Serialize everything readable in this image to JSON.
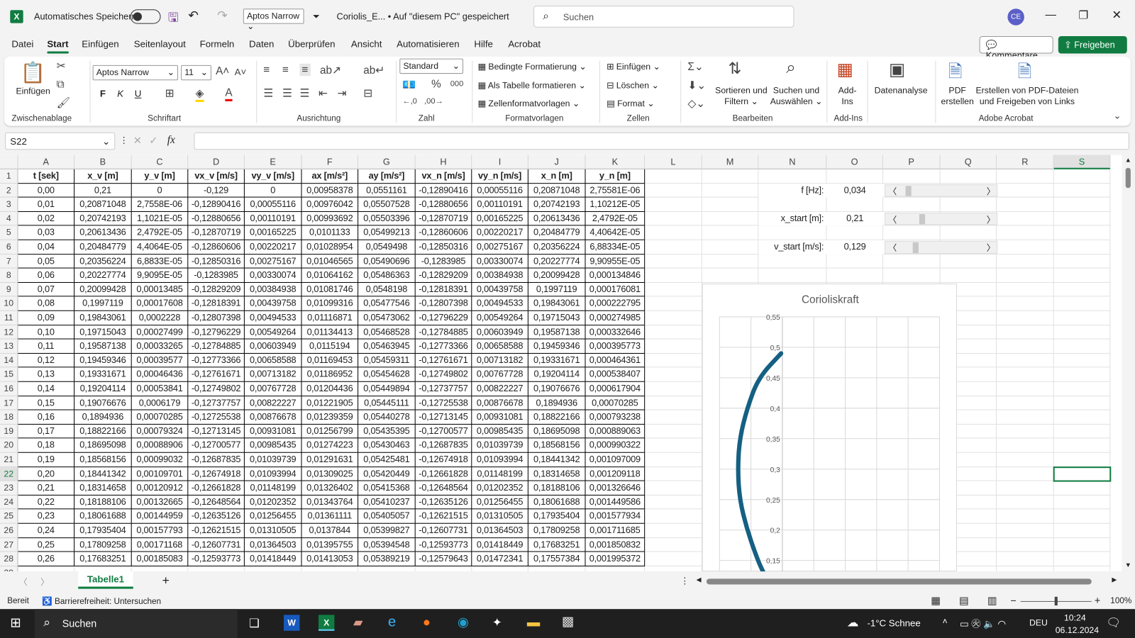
{
  "titlebar": {
    "autosave": "Automatisches Speichern",
    "font_quick": "Aptos Narrow",
    "doc_title": "Coriolis_E... • Auf \"diesem PC\" gespeichert",
    "search_placeholder": "Suchen",
    "avatar": "CE"
  },
  "menu": {
    "tabs": [
      "Datei",
      "Start",
      "Einfügen",
      "Seitenlayout",
      "Formeln",
      "Daten",
      "Überprüfen",
      "Ansicht",
      "Automatisieren",
      "Hilfe",
      "Acrobat"
    ],
    "active": "Start",
    "comments": "Kommentare",
    "share": "Freigeben"
  },
  "ribbon": {
    "clipboard": {
      "paste": "Einfügen",
      "label": "Zwischenablage"
    },
    "font": {
      "name": "Aptos Narrow",
      "size": "11",
      "bold": "F",
      "italic": "K",
      "underline": "U",
      "label": "Schriftart"
    },
    "alignment": {
      "label": "Ausrichtung"
    },
    "number": {
      "format": "Standard",
      "label": "Zahl"
    },
    "styles": {
      "conditional": "Bedingte Formatierung",
      "as_table": "Als Tabelle formatieren",
      "cell_styles": "Zellenformatvorlagen",
      "label": "Formatvorlagen"
    },
    "cells": {
      "insert": "Einfügen",
      "delete": "Löschen",
      "format": "Format",
      "label": "Zellen"
    },
    "editing": {
      "sort1": "Sortieren und",
      "sort2": "Filtern",
      "find1": "Suchen und",
      "find2": "Auswählen",
      "label": "Bearbeiten"
    },
    "addins": {
      "btn1": "Add-",
      "btn2": "Ins",
      "label": "Add-Ins"
    },
    "analysis": {
      "btn": "Datenanalyse"
    },
    "acrobat": {
      "pdf1": "PDF",
      "pdf2": "erstellen",
      "share1": "Erstellen von PDF-Dateien",
      "share2": "und Freigeben von Links",
      "label": "Adobe Acrobat"
    }
  },
  "formula_bar": {
    "name_box": "S22",
    "fx": "fx",
    "value": ""
  },
  "columns": [
    "A",
    "B",
    "C",
    "D",
    "E",
    "F",
    "G",
    "H",
    "I",
    "J",
    "K",
    "L",
    "M",
    "N",
    "O",
    "P",
    "Q",
    "R",
    "S"
  ],
  "table": {
    "headers": [
      "t [sek]",
      "x_v [m]",
      "y_v [m]",
      "vx_v [m/s]",
      "vy_v [m/s]",
      "ax [m/s²]",
      "ay [m/s²]",
      "vx_n [m/s]",
      "vy_n [m/s]",
      "x_n [m]",
      "y_n [m]"
    ],
    "rows": [
      [
        "0,00",
        "0,21",
        "0",
        "-0,129",
        "0",
        "0,00958378",
        "0,0551161",
        "-0,12890416",
        "0,00055116",
        "0,20871048",
        "2,75581E-06"
      ],
      [
        "0,01",
        "0,20871048",
        "2,7558E-06",
        "-0,12890416",
        "0,00055116",
        "0,00976042",
        "0,05507528",
        "-0,12880656",
        "0,00110191",
        "0,20742193",
        "1,10212E-05"
      ],
      [
        "0,02",
        "0,20742193",
        "1,1021E-05",
        "-0,12880656",
        "0,00110191",
        "0,00993692",
        "0,05503396",
        "-0,12870719",
        "0,00165225",
        "0,20613436",
        "2,4792E-05"
      ],
      [
        "0,03",
        "0,20613436",
        "2,4792E-05",
        "-0,12870719",
        "0,00165225",
        "0,0101133",
        "0,05499213",
        "-0,12860606",
        "0,00220217",
        "0,20484779",
        "4,40642E-05"
      ],
      [
        "0,04",
        "0,20484779",
        "4,4064E-05",
        "-0,12860606",
        "0,00220217",
        "0,01028954",
        "0,0549498",
        "-0,12850316",
        "0,00275167",
        "0,20356224",
        "6,88334E-05"
      ],
      [
        "0,05",
        "0,20356224",
        "6,8833E-05",
        "-0,12850316",
        "0,00275167",
        "0,01046565",
        "0,05490696",
        "-0,1283985",
        "0,00330074",
        "0,20227774",
        "9,90955E-05"
      ],
      [
        "0,06",
        "0,20227774",
        "9,9095E-05",
        "-0,1283985",
        "0,00330074",
        "0,01064162",
        "0,05486363",
        "-0,12829209",
        "0,00384938",
        "0,20099428",
        "0,000134846"
      ],
      [
        "0,07",
        "0,20099428",
        "0,00013485",
        "-0,12829209",
        "0,00384938",
        "0,01081746",
        "0,0548198",
        "-0,12818391",
        "0,00439758",
        "0,1997119",
        "0,000176081"
      ],
      [
        "0,08",
        "0,1997119",
        "0,00017608",
        "-0,12818391",
        "0,00439758",
        "0,01099316",
        "0,05477546",
        "-0,12807398",
        "0,00494533",
        "0,19843061",
        "0,000222795"
      ],
      [
        "0,09",
        "0,19843061",
        "0,0002228",
        "-0,12807398",
        "0,00494533",
        "0,01116871",
        "0,05473062",
        "-0,12796229",
        "0,00549264",
        "0,19715043",
        "0,000274985"
      ],
      [
        "0,10",
        "0,19715043",
        "0,00027499",
        "-0,12796229",
        "0,00549264",
        "0,01134413",
        "0,05468528",
        "-0,12784885",
        "0,00603949",
        "0,19587138",
        "0,000332646"
      ],
      [
        "0,11",
        "0,19587138",
        "0,00033265",
        "-0,12784885",
        "0,00603949",
        "0,0115194",
        "0,05463945",
        "-0,12773366",
        "0,00658588",
        "0,19459346",
        "0,000395773"
      ],
      [
        "0,12",
        "0,19459346",
        "0,00039577",
        "-0,12773366",
        "0,00658588",
        "0,01169453",
        "0,05459311",
        "-0,12761671",
        "0,00713182",
        "0,19331671",
        "0,000464361"
      ],
      [
        "0,13",
        "0,19331671",
        "0,00046436",
        "-0,12761671",
        "0,00713182",
        "0,01186952",
        "0,05454628",
        "-0,12749802",
        "0,00767728",
        "0,19204114",
        "0,000538407"
      ],
      [
        "0,14",
        "0,19204114",
        "0,00053841",
        "-0,12749802",
        "0,00767728",
        "0,01204436",
        "0,05449894",
        "-0,12737757",
        "0,00822227",
        "0,19076676",
        "0,000617904"
      ],
      [
        "0,15",
        "0,19076676",
        "0,0006179",
        "-0,12737757",
        "0,00822227",
        "0,01221905",
        "0,05445111",
        "-0,12725538",
        "0,00876678",
        "0,1894936",
        "0,00070285"
      ],
      [
        "0,16",
        "0,1894936",
        "0,00070285",
        "-0,12725538",
        "0,00876678",
        "0,01239359",
        "0,05440278",
        "-0,12713145",
        "0,00931081",
        "0,18822166",
        "0,000793238"
      ],
      [
        "0,17",
        "0,18822166",
        "0,00079324",
        "-0,12713145",
        "0,00931081",
        "0,01256799",
        "0,05435395",
        "-0,12700577",
        "0,00985435",
        "0,18695098",
        "0,000889063"
      ],
      [
        "0,18",
        "0,18695098",
        "0,00088906",
        "-0,12700577",
        "0,00985435",
        "0,01274223",
        "0,05430463",
        "-0,12687835",
        "0,01039739",
        "0,18568156",
        "0,000990322"
      ],
      [
        "0,19",
        "0,18568156",
        "0,00099032",
        "-0,12687835",
        "0,01039739",
        "0,01291631",
        "0,05425481",
        "-0,12674918",
        "0,01093994",
        "0,18441342",
        "0,001097009"
      ],
      [
        "0,20",
        "0,18441342",
        "0,00109701",
        "-0,12674918",
        "0,01093994",
        "0,01309025",
        "0,05420449",
        "-0,12661828",
        "0,01148199",
        "0,18314658",
        "0,001209118"
      ],
      [
        "0,21",
        "0,18314658",
        "0,00120912",
        "-0,12661828",
        "0,01148199",
        "0,01326402",
        "0,05415368",
        "-0,12648564",
        "0,01202352",
        "0,18188106",
        "0,001326646"
      ],
      [
        "0,22",
        "0,18188106",
        "0,00132665",
        "-0,12648564",
        "0,01202352",
        "0,01343764",
        "0,05410237",
        "-0,12635126",
        "0,01256455",
        "0,18061688",
        "0,001449586"
      ],
      [
        "0,23",
        "0,18061688",
        "0,00144959",
        "-0,12635126",
        "0,01256455",
        "0,01361111",
        "0,05405057",
        "-0,12621515",
        "0,01310505",
        "0,17935404",
        "0,001577934"
      ],
      [
        "0,24",
        "0,17935404",
        "0,00157793",
        "-0,12621515",
        "0,01310505",
        "0,0137844",
        "0,05399827",
        "-0,12607731",
        "0,01364503",
        "0,17809258",
        "0,001711685"
      ],
      [
        "0,25",
        "0,17809258",
        "0,00171168",
        "-0,12607731",
        "0,01364503",
        "0,01395755",
        "0,05394548",
        "-0,12593773",
        "0,01418449",
        "0,17683251",
        "0,001850832"
      ],
      [
        "0,26",
        "0,17683251",
        "0,00185083",
        "-0,12593773",
        "0,01418449",
        "0,01413053",
        "0,05389219",
        "-0,12579643",
        "0,01472341",
        "0,17557384",
        "0,001995372"
      ]
    ]
  },
  "controls": [
    {
      "label": "f [Hz]:",
      "value": "0,034",
      "slider_fraction": 0.08
    },
    {
      "label": "x_start [m]:",
      "value": "0,21",
      "slider_fraction": 0.24
    },
    {
      "label": "v_start [m/s]:",
      "value": "0,129",
      "slider_fraction": 0.17
    }
  ],
  "selected_cell": "S22",
  "chart_data": {
    "type": "scatter",
    "title": "Corioliskraft",
    "line_color": "#156082",
    "grid": true,
    "yticks": [
      "0,55",
      "0,5",
      "0,45",
      "0,4",
      "0,35",
      "0,3",
      "0,25",
      "0,2",
      "0,15"
    ],
    "ytick_values": [
      0.55,
      0.5,
      0.45,
      0.4,
      0.35,
      0.3,
      0.25,
      0.2,
      0.15
    ],
    "points": [
      [
        -0.002,
        0.49
      ],
      [
        -0.038,
        0.45
      ],
      [
        -0.056,
        0.4
      ],
      [
        -0.068,
        0.35
      ],
      [
        -0.071,
        0.3
      ],
      [
        -0.068,
        0.25
      ],
      [
        -0.056,
        0.2
      ],
      [
        -0.039,
        0.15
      ],
      [
        -0.03,
        0.13
      ]
    ]
  },
  "sheet": {
    "tab": "Tabelle1"
  },
  "status": {
    "ready": "Bereit",
    "accessibility": "Barrierefreiheit: Untersuchen",
    "zoom": "100%"
  },
  "taskbar": {
    "search": "Suchen",
    "weather": "-1°C  Schnee",
    "lang": "DEU",
    "time": "10:24",
    "date": "06.12.2024"
  }
}
